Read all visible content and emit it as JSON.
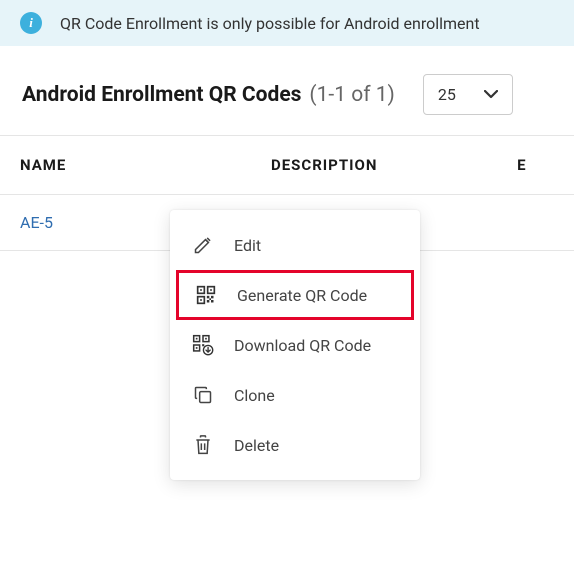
{
  "banner": {
    "text": "QR Code Enrollment is only possible for Android enrollment"
  },
  "header": {
    "title": "Android Enrollment QR Codes",
    "count_text": "(1-1 of 1)",
    "page_size_value": "25"
  },
  "table": {
    "columns": {
      "name": "NAME",
      "description": "DESCRIPTION",
      "extra": "E"
    },
    "rows": [
      {
        "name": "AE-5"
      }
    ]
  },
  "menu": {
    "edit": "Edit",
    "generate": "Generate QR Code",
    "download": "Download QR Code",
    "clone": "Clone",
    "delete": "Delete"
  }
}
